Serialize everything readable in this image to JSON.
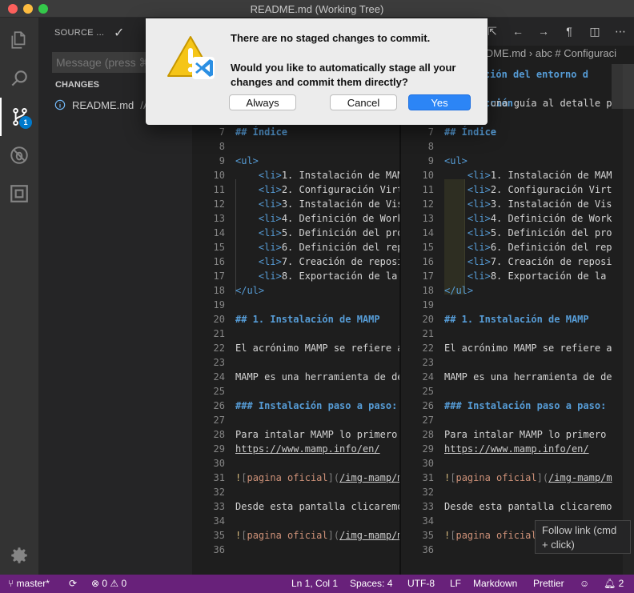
{
  "window": {
    "title": "README.md (Working Tree)"
  },
  "activity": {
    "items": [
      {
        "name": "explorer-icon"
      },
      {
        "name": "search-icon"
      },
      {
        "name": "source-control-icon",
        "badge": "1"
      },
      {
        "name": "debug-icon"
      },
      {
        "name": "extensions-icon"
      }
    ],
    "settings": "gear-icon"
  },
  "sidebar": {
    "header": "SOURCE ...",
    "commit_icon": "✓",
    "message_placeholder": "Message (press ⌘",
    "changes_header": "CHANGES",
    "change_file": "README.md",
    "change_path": "/A"
  },
  "editor": {
    "breadcrumb": "README.md › abc # Configuraci",
    "right_header": "guración del entorno d",
    "right_intro": "roducción",
    "lines": [
      {
        "n": "5",
        "t": "Esto es una guía al detalle p",
        "k": "plain"
      },
      {
        "n": "6",
        "t": "",
        "k": "plain"
      },
      {
        "n": "7",
        "t": "## Índice",
        "k": "h"
      },
      {
        "n": "8",
        "t": "",
        "k": "plain"
      },
      {
        "n": "9",
        "t": "<ul>",
        "k": "ul"
      },
      {
        "n": "10",
        "t": "1. Instalación de MAM",
        "k": "li"
      },
      {
        "n": "11",
        "t": "2. Configuración Virt",
        "k": "li"
      },
      {
        "n": "12",
        "t": "3. Instalación de Vis",
        "k": "li"
      },
      {
        "n": "13",
        "t": "4. Definición de Work",
        "k": "li"
      },
      {
        "n": "14",
        "t": "5. Definición del pro",
        "k": "li"
      },
      {
        "n": "15",
        "t": "6. Definición del rep",
        "k": "li"
      },
      {
        "n": "16",
        "t": "7. Creación de reposi",
        "k": "li"
      },
      {
        "n": "17",
        "t": "8. Exportación de la",
        "k": "li"
      },
      {
        "n": "18",
        "t": "</ul>",
        "k": "ul"
      },
      {
        "n": "19",
        "t": "",
        "k": "plain"
      },
      {
        "n": "20",
        "t": "## 1. Instalación de MAMP",
        "k": "h"
      },
      {
        "n": "21",
        "t": "",
        "k": "plain"
      },
      {
        "n": "22",
        "t": "El acrónimo MAMP se refiere a",
        "k": "plain"
      },
      {
        "n": "23",
        "t": "",
        "k": "plain"
      },
      {
        "n": "24",
        "t": "MAMP es una herramienta de de",
        "k": "plain"
      },
      {
        "n": "25",
        "t": "",
        "k": "plain"
      },
      {
        "n": "26",
        "t": "### Instalación paso a paso:",
        "k": "h"
      },
      {
        "n": "27",
        "t": "",
        "k": "plain"
      },
      {
        "n": "28",
        "t": "Para intalar MAMP lo primero",
        "k": "plain"
      },
      {
        "n": "29",
        "t": "https://www.mamp.info/en/",
        "k": "url"
      },
      {
        "n": "30",
        "t": "",
        "k": "plain"
      },
      {
        "n": "31",
        "t": "pagina oficial",
        "k": "img",
        "p": "/img-mamp/m"
      },
      {
        "n": "32",
        "t": "",
        "k": "plain"
      },
      {
        "n": "33",
        "t": "Desde esta pantalla clicaremo",
        "k": "plain"
      },
      {
        "n": "34",
        "t": "",
        "k": "plain"
      },
      {
        "n": "35",
        "t": "pagina oficial",
        "k": "img",
        "p": "/img-mamp/m"
      },
      {
        "n": "36",
        "t": "",
        "k": "plain"
      }
    ]
  },
  "tooltip": {
    "text": "Follow link (cmd + click)"
  },
  "status": {
    "branch": "master*",
    "errors": "0",
    "warnings": "0",
    "cursor": "Ln 1, Col 1",
    "spaces": "Spaces: 4",
    "encoding": "UTF-8",
    "eol": "LF",
    "language": "Markdown",
    "formatter": "Prettier",
    "notifications": "2"
  },
  "dialog": {
    "message": "There are no staged changes to commit.",
    "detail": "Would you like to automatically stage all your changes and commit them directly?",
    "buttons": {
      "always": "Always",
      "cancel": "Cancel",
      "yes": "Yes"
    }
  },
  "colors": {
    "statusbar": "#68217a",
    "accent": "#007acc",
    "dialog_default": "#2c85f6"
  }
}
